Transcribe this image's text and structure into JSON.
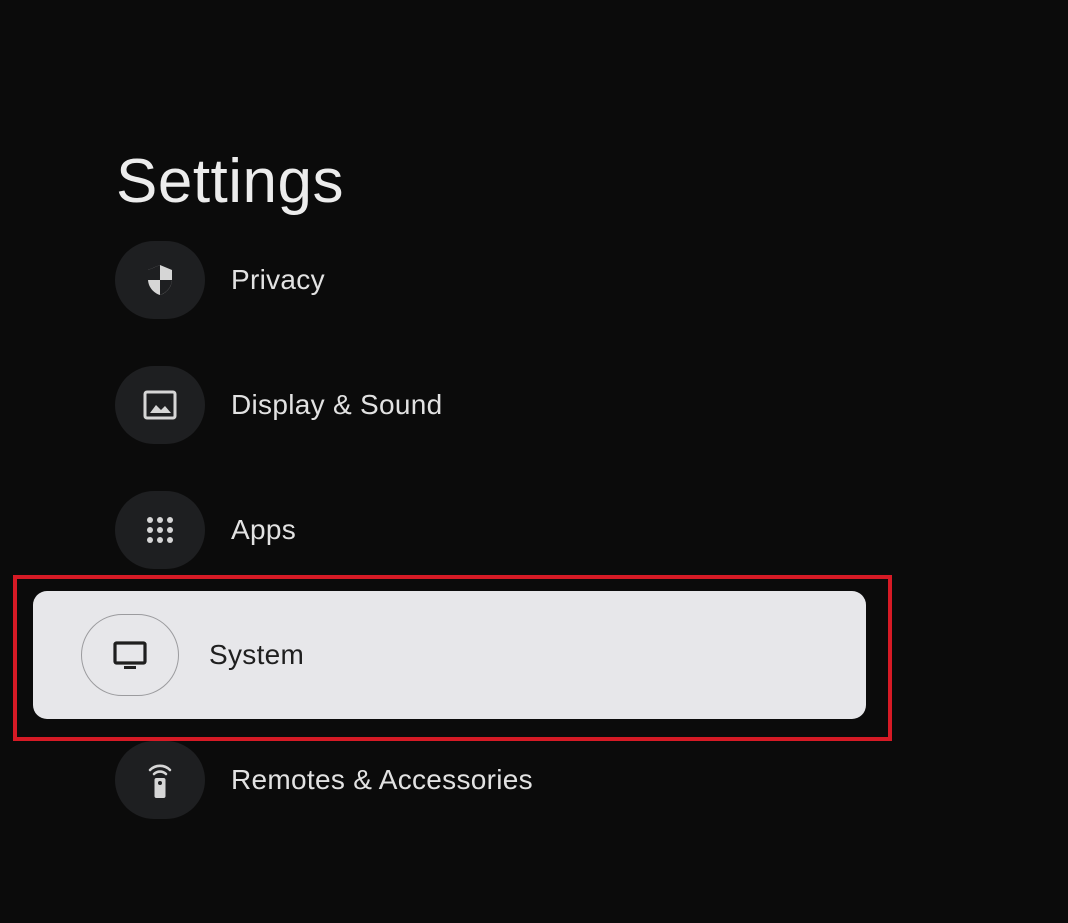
{
  "page": {
    "title": "Settings"
  },
  "menu": {
    "items": [
      {
        "label": "Privacy",
        "icon": "shield-icon",
        "selected": false
      },
      {
        "label": "Display & Sound",
        "icon": "image-icon",
        "selected": false
      },
      {
        "label": "Apps",
        "icon": "apps-grid-icon",
        "selected": false
      },
      {
        "label": "System",
        "icon": "tv-icon",
        "selected": true
      },
      {
        "label": "Remotes & Accessories",
        "icon": "remote-icon",
        "selected": false
      }
    ]
  },
  "colors": {
    "background": "#0b0b0b",
    "selected_background": "#e7e7ea",
    "highlight_annotation": "#d61a25"
  }
}
